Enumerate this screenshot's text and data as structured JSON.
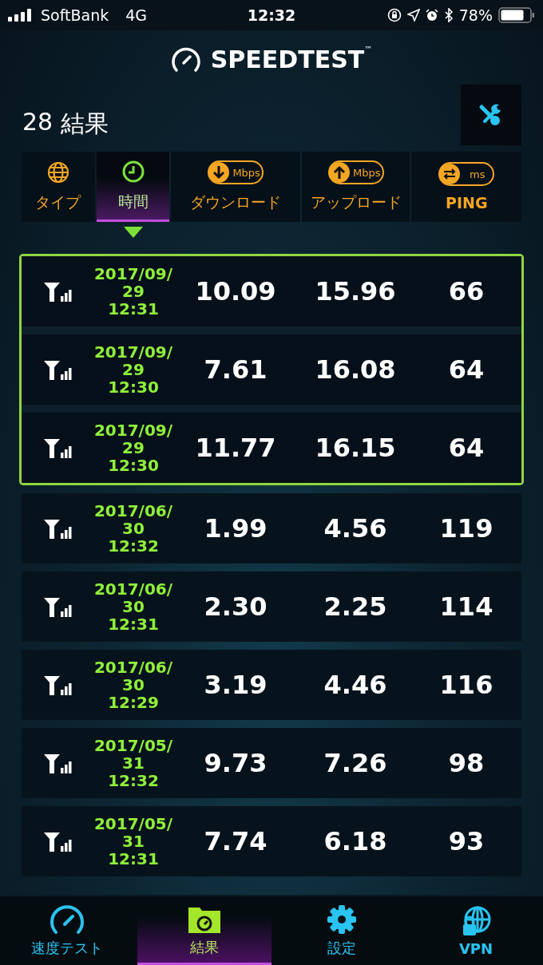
{
  "status_bar": {
    "carrier": "SoftBank",
    "network": "4G",
    "time": "12:32",
    "battery": "78%"
  },
  "header": {
    "logo": "SPEEDTEST",
    "trademark": "™"
  },
  "results": {
    "count": "28",
    "title": "結果"
  },
  "columns": [
    {
      "kind": "type",
      "label": "タイプ",
      "selected": false
    },
    {
      "kind": "time",
      "label": "時間",
      "selected": true
    },
    {
      "kind": "down",
      "label": "ダウンロード",
      "unit": "Mbps",
      "selected": false
    },
    {
      "kind": "up",
      "label": "アップロード",
      "unit": "Mbps",
      "selected": false
    },
    {
      "kind": "ping",
      "label": "PING",
      "unit": "ms",
      "selected": false
    }
  ],
  "rows": [
    {
      "date": "2017/09/",
      "day": "29",
      "time": "12:31",
      "download": "10.09",
      "upload": "15.96",
      "ping": "66",
      "selected": true
    },
    {
      "date": "2017/09/",
      "day": "29",
      "time": "12:30",
      "download": "7.61",
      "upload": "16.08",
      "ping": "64",
      "selected": true
    },
    {
      "date": "2017/09/",
      "day": "29",
      "time": "12:30",
      "download": "11.77",
      "upload": "16.15",
      "ping": "64",
      "selected": true
    },
    {
      "date": "2017/06/",
      "day": "30",
      "time": "12:32",
      "download": "1.99",
      "upload": "4.56",
      "ping": "119",
      "selected": false
    },
    {
      "date": "2017/06/",
      "day": "30",
      "time": "12:31",
      "download": "2.30",
      "upload": "2.25",
      "ping": "114",
      "selected": false
    },
    {
      "date": "2017/06/",
      "day": "30",
      "time": "12:29",
      "download": "3.19",
      "upload": "4.46",
      "ping": "116",
      "selected": false
    },
    {
      "date": "2017/05/",
      "day": "31",
      "time": "12:32",
      "download": "9.73",
      "upload": "7.26",
      "ping": "98",
      "selected": false
    },
    {
      "date": "2017/05/",
      "day": "31",
      "time": "12:31",
      "download": "7.74",
      "upload": "6.18",
      "ping": "93",
      "selected": false
    }
  ],
  "tab_bar": [
    {
      "kind": "speed",
      "label": "速度テスト",
      "selected": false
    },
    {
      "kind": "results",
      "label": "結果",
      "selected": true
    },
    {
      "kind": "settings",
      "label": "設定",
      "selected": false
    },
    {
      "kind": "vpn",
      "label": "VPN",
      "selected": false
    }
  ]
}
